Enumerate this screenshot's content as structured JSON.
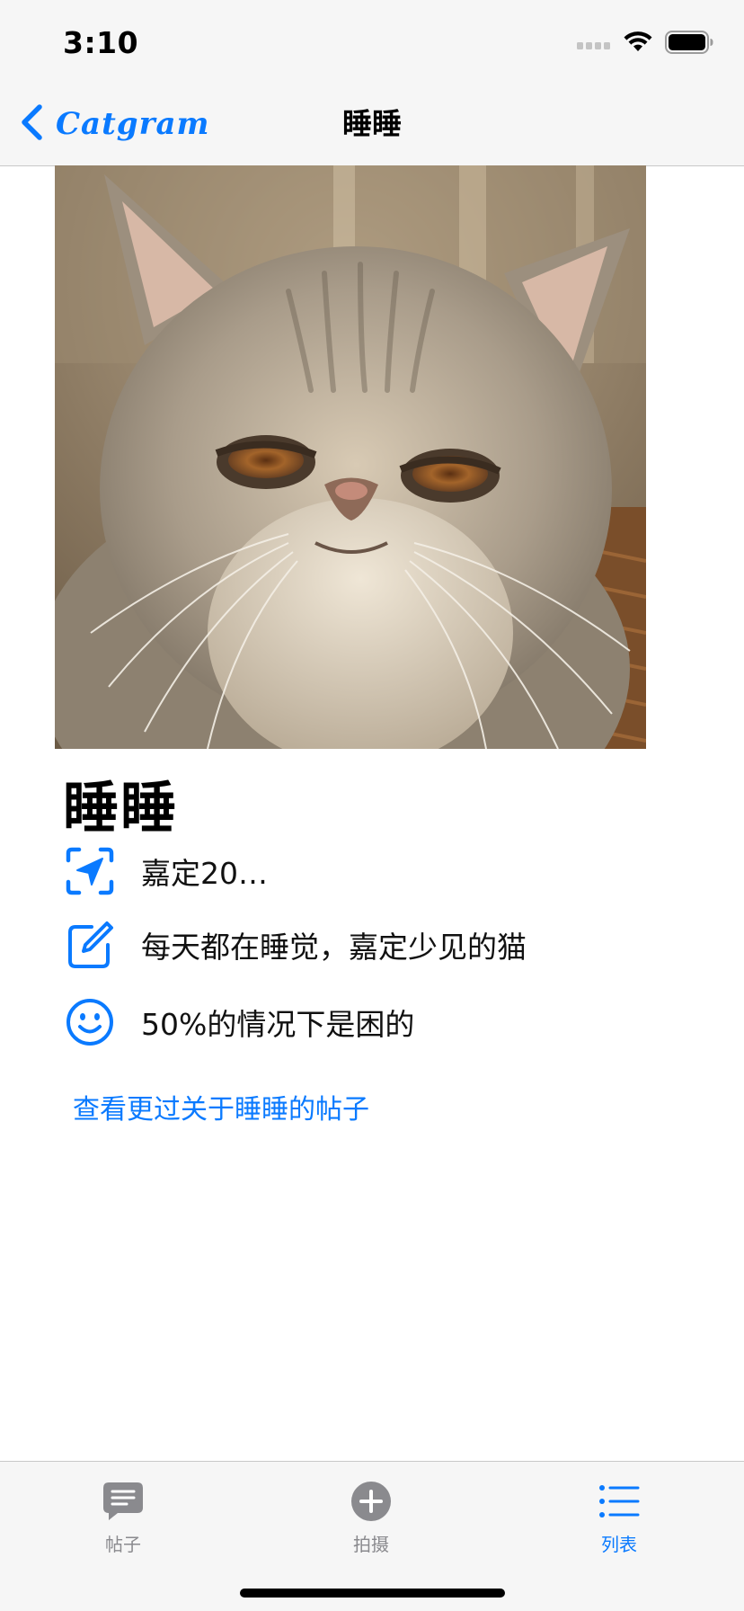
{
  "status_bar": {
    "time": "3:10"
  },
  "nav": {
    "back_label": "Catgram",
    "title": "睡睡"
  },
  "detail": {
    "name": "睡睡",
    "location": "嘉定20…",
    "description": "每天都在睡觉，嘉定少见的猫",
    "mood": "50%的情况下是困的",
    "more_link": "查看更过关于睡睡的帖子"
  },
  "tabs": [
    {
      "label": "帖子",
      "icon": "message-bubble-icon",
      "active": false
    },
    {
      "label": "拍摄",
      "icon": "plus-circle-icon",
      "active": false
    },
    {
      "label": "列表",
      "icon": "list-icon",
      "active": true
    }
  ],
  "colors": {
    "accent": "#0a7aff",
    "inactive": "#8a8a8e",
    "bar_background": "#f6f6f6"
  }
}
